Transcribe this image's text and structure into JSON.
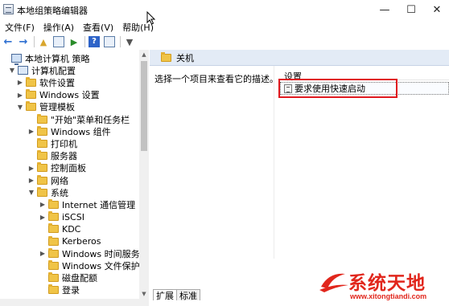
{
  "window": {
    "title": "本地组策略编辑器",
    "min": "—",
    "max": "☐",
    "close": "✕"
  },
  "menubar": [
    "文件(F)",
    "操作(A)",
    "查看(V)",
    "帮助(H)"
  ],
  "toolbar": [
    "back-icon",
    "forward-icon",
    "up-folder-icon",
    "show-pane-icon",
    "export-icon",
    "help-icon",
    "pane-icon",
    "filter-icon"
  ],
  "tree": [
    {
      "label": "本地计算机 策略",
      "depth": 0,
      "arrow": "",
      "icon": "computer-icon"
    },
    {
      "label": "计算机配置",
      "depth": 1,
      "arrow": "▼",
      "icon": "config-icon"
    },
    {
      "label": "软件设置",
      "depth": 2,
      "arrow": "▶",
      "icon": "folder-icon"
    },
    {
      "label": "Windows 设置",
      "depth": 2,
      "arrow": "▶",
      "icon": "folder-icon"
    },
    {
      "label": "管理模板",
      "depth": 2,
      "arrow": "▼",
      "icon": "folder-icon"
    },
    {
      "label": "\"开始\"菜单和任务栏",
      "depth": 3,
      "arrow": "",
      "icon": "folder-icon"
    },
    {
      "label": "Windows 组件",
      "depth": 3,
      "arrow": "▶",
      "icon": "folder-icon"
    },
    {
      "label": "打印机",
      "depth": 3,
      "arrow": "",
      "icon": "folder-icon"
    },
    {
      "label": "服务器",
      "depth": 3,
      "arrow": "",
      "icon": "folder-icon"
    },
    {
      "label": "控制面板",
      "depth": 3,
      "arrow": "▶",
      "icon": "folder-icon"
    },
    {
      "label": "网络",
      "depth": 3,
      "arrow": "▶",
      "icon": "folder-icon"
    },
    {
      "label": "系统",
      "depth": 3,
      "arrow": "▼",
      "icon": "folder-icon"
    },
    {
      "label": "Internet 通信管理",
      "depth": 4,
      "arrow": "▶",
      "icon": "folder-icon"
    },
    {
      "label": "iSCSI",
      "depth": 4,
      "arrow": "▶",
      "icon": "folder-icon"
    },
    {
      "label": "KDC",
      "depth": 4,
      "arrow": "",
      "icon": "folder-icon"
    },
    {
      "label": "Kerberos",
      "depth": 4,
      "arrow": "",
      "icon": "folder-icon"
    },
    {
      "label": "Windows 时间服务",
      "depth": 4,
      "arrow": "▶",
      "icon": "folder-icon"
    },
    {
      "label": "Windows 文件保护",
      "depth": 4,
      "arrow": "",
      "icon": "folder-icon"
    },
    {
      "label": "磁盘配额",
      "depth": 4,
      "arrow": "",
      "icon": "folder-icon"
    },
    {
      "label": "登录",
      "depth": 4,
      "arrow": "",
      "icon": "folder-icon"
    }
  ],
  "right": {
    "folder_title": "关机",
    "description": "选择一个项目来查看它的描述。",
    "column_header": "设置",
    "settings": [
      "要求使用快速启动"
    ]
  },
  "tabs": [
    "扩展",
    "标准"
  ],
  "watermark": {
    "brand": "系统天地",
    "url": "www.xitongtiandi.com"
  },
  "colors": {
    "header_bg": "#e3ebf6",
    "highlight": "#e0191f",
    "brand": "#e1261c"
  }
}
